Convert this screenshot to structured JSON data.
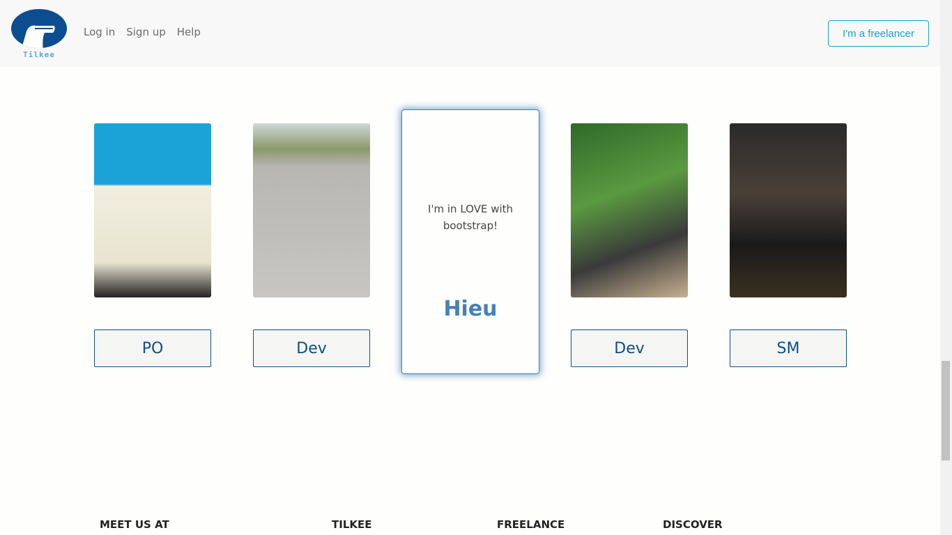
{
  "header": {
    "logo_text": "Tilkee",
    "links": [
      "Log in",
      "Sign up",
      "Help"
    ],
    "freelancer_button": "I'm a freelancer",
    "accent": "#17a2c8",
    "brand": "#0b4d8f"
  },
  "team": [
    {
      "role": "PO"
    },
    {
      "role": "Dev"
    },
    {
      "role": "Dev"
    },
    {
      "role": "SM"
    }
  ],
  "featured": {
    "quote": "I'm in LOVE with bootstrap!",
    "name": "Hieu"
  },
  "footer": {
    "headings": [
      "MEET US AT",
      "TILKEE",
      "FREELANCE",
      "DISCOVER"
    ]
  }
}
